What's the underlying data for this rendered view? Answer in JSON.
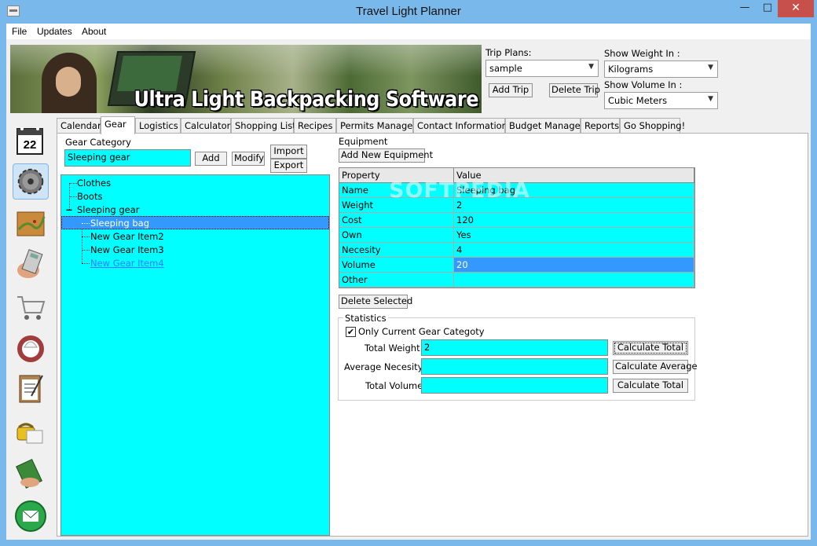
{
  "window": {
    "title": "Travel Light Planner",
    "minimize": "—",
    "maximize": "□",
    "close": "✕"
  },
  "menu": [
    "File",
    "Updates",
    "About"
  ],
  "banner": {
    "text": "Ultra Light Backpacking Software"
  },
  "trip": {
    "label": "Trip Plans:",
    "value": "sample",
    "add_label": "Add Trip",
    "delete_label": "Delete Trip"
  },
  "weight": {
    "label": "Show Weight In :",
    "value": "Kilograms"
  },
  "volume": {
    "label": "Show Volume In :",
    "value": "Cubic Meters"
  },
  "tabs": [
    "Calendar",
    "Gear",
    "Logistics",
    "Calculator",
    "Shopping List",
    "Recipes",
    "Permits Manager",
    "Contact Information",
    "Budget Manager",
    "Reports",
    "Go Shopping!"
  ],
  "gear_category": {
    "label": "Gear Category",
    "value": "Sleeping gear",
    "add_label": "Add",
    "modify_label": "Modify",
    "import_label": "Import",
    "export_label": "Export"
  },
  "tree": {
    "items": [
      "Clothes",
      "Boots",
      "Sleeping gear"
    ],
    "children": [
      "Sleeping bag",
      "New Gear Item2",
      "New Gear Item3",
      "New Gear Item4"
    ],
    "expander": "−"
  },
  "equipment": {
    "label": "Equipment",
    "add_label": "Add New Equipment",
    "col_property": "Property",
    "col_value": "Value",
    "rows": [
      [
        "Name",
        "Sleeping bag"
      ],
      [
        "Weight",
        "2"
      ],
      [
        "Cost",
        "120"
      ],
      [
        "Own",
        "Yes"
      ],
      [
        "Necesity",
        "4"
      ],
      [
        "Volume",
        "20"
      ],
      [
        "Other",
        ""
      ]
    ],
    "delete_label": "Delete Selected"
  },
  "statistics": {
    "label": "Statistics",
    "only_current_label": "Only Current Gear Categoty",
    "only_current_checked": "✔",
    "total_weight_label": "Total Weight:",
    "total_weight_value": "2",
    "avg_necesity_label": "Average Necesity:",
    "avg_necesity_value": "",
    "total_volume_label": "Total Volume:",
    "total_volume_value": "",
    "calc_total_label": "Calculate Total",
    "calc_avg_label": "Calculate Average",
    "calc_total2_label": "Calculate Total"
  },
  "watermark": "SOFTPEDIA",
  "colors": {
    "field_bg": "#00ffff",
    "selection": "#3399ff",
    "link": "#3a7cff"
  },
  "sidebar_icons": [
    "calendar-icon",
    "gear-icon",
    "map-icon",
    "calculator-icon",
    "shopping-cart-icon",
    "recipes-icon",
    "clipboard-icon",
    "phone-icon",
    "money-icon",
    "email-icon"
  ],
  "calendar_day": "22"
}
